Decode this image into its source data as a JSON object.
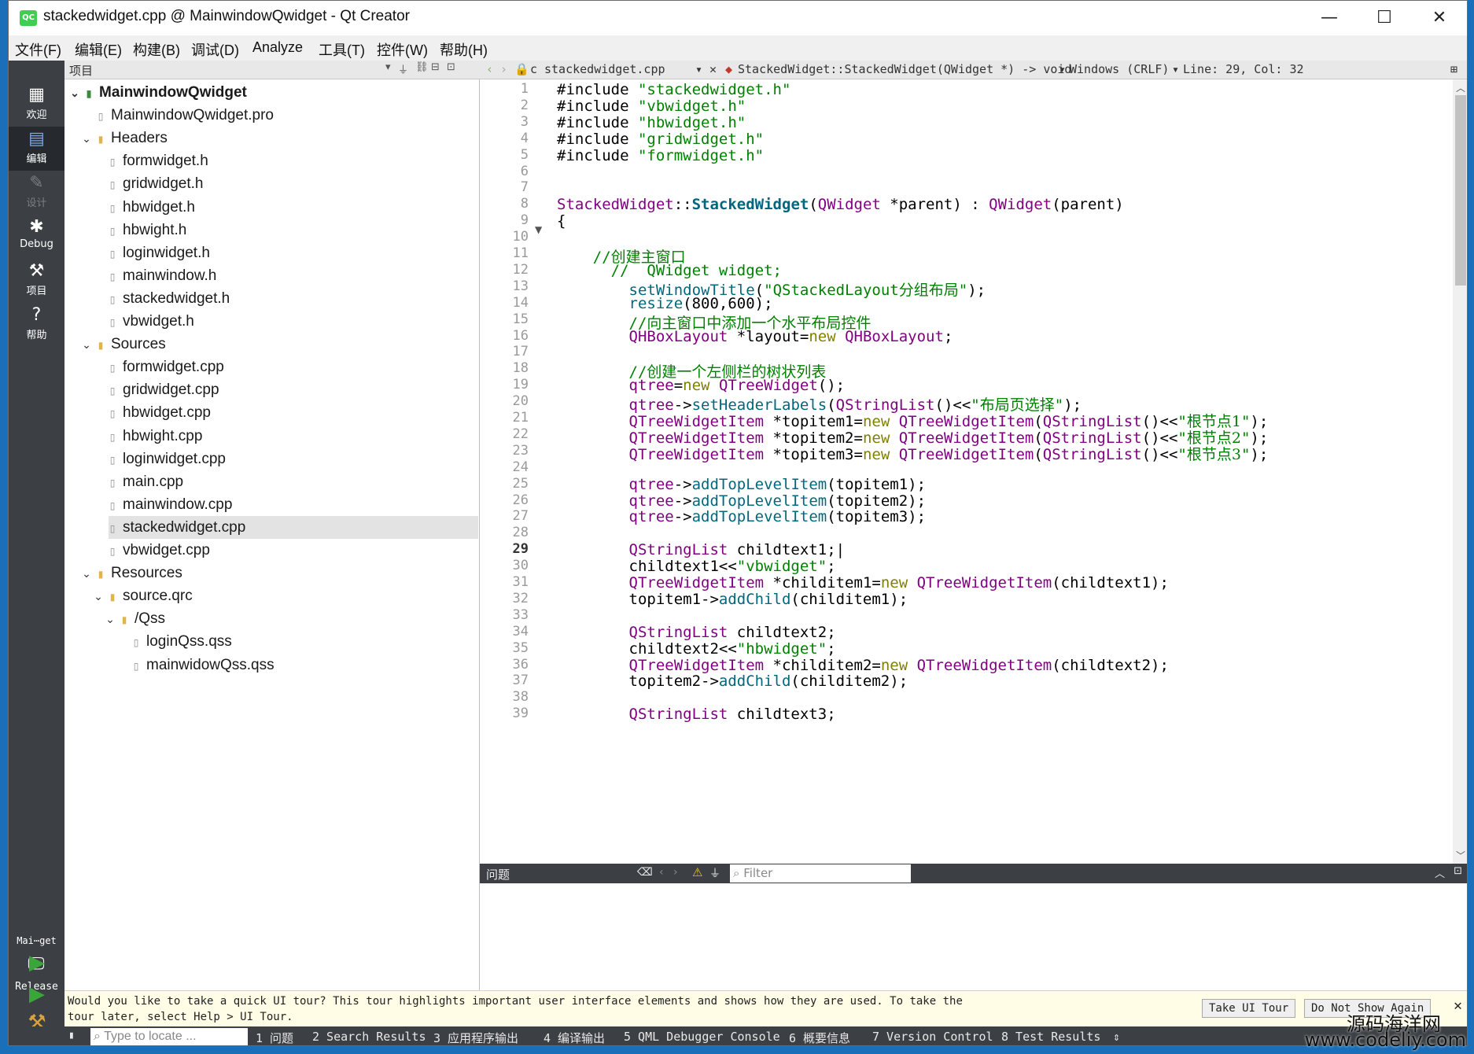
{
  "window": {
    "title": "stackedwidget.cpp @ MainwindowQwidget - Qt Creator",
    "app_icon": "QC",
    "minimize": "—",
    "maximize": "☐",
    "close": "✕"
  },
  "menubar": [
    "文件(F)",
    "编辑(E)",
    "构建(B)",
    "调试(D)",
    "Analyze",
    "工具(T)",
    "控件(W)",
    "帮助(H)"
  ],
  "modes": [
    {
      "label": "欢迎",
      "icon": "grid-icon"
    },
    {
      "label": "编辑",
      "icon": "edit-icon"
    },
    {
      "label": "设计",
      "icon": "pencil-icon"
    },
    {
      "label": "Debug",
      "icon": "bug-icon"
    },
    {
      "label": "项目",
      "icon": "wrench-icon"
    },
    {
      "label": "帮助",
      "icon": "help-icon"
    }
  ],
  "kit": {
    "project": "Mai⋯get",
    "config": "Release"
  },
  "project_pane": {
    "title": "项目",
    "tree": [
      {
        "label": "MainwindowQwidget",
        "level": 0,
        "expanded": true,
        "kind": "root"
      },
      {
        "label": "MainwindowQwidget.pro",
        "level": 1,
        "kind": "file"
      },
      {
        "label": "Headers",
        "level": 1,
        "expanded": true,
        "kind": "folder"
      },
      {
        "label": "formwidget.h",
        "level": 2,
        "kind": "file"
      },
      {
        "label": "gridwidget.h",
        "level": 2,
        "kind": "file"
      },
      {
        "label": "hbwidget.h",
        "level": 2,
        "kind": "file"
      },
      {
        "label": "hbwight.h",
        "level": 2,
        "kind": "file"
      },
      {
        "label": "loginwidget.h",
        "level": 2,
        "kind": "file"
      },
      {
        "label": "mainwindow.h",
        "level": 2,
        "kind": "file"
      },
      {
        "label": "stackedwidget.h",
        "level": 2,
        "kind": "file"
      },
      {
        "label": "vbwidget.h",
        "level": 2,
        "kind": "file"
      },
      {
        "label": "Sources",
        "level": 1,
        "expanded": true,
        "kind": "folder"
      },
      {
        "label": "formwidget.cpp",
        "level": 2,
        "kind": "file"
      },
      {
        "label": "gridwidget.cpp",
        "level": 2,
        "kind": "file"
      },
      {
        "label": "hbwidget.cpp",
        "level": 2,
        "kind": "file"
      },
      {
        "label": "hbwight.cpp",
        "level": 2,
        "kind": "file"
      },
      {
        "label": "loginwidget.cpp",
        "level": 2,
        "kind": "file"
      },
      {
        "label": "main.cpp",
        "level": 2,
        "kind": "file"
      },
      {
        "label": "mainwindow.cpp",
        "level": 2,
        "kind": "file"
      },
      {
        "label": "stackedwidget.cpp",
        "level": 2,
        "kind": "file",
        "selected": true
      },
      {
        "label": "vbwidget.cpp",
        "level": 2,
        "kind": "file"
      },
      {
        "label": "Resources",
        "level": 1,
        "expanded": true,
        "kind": "folder"
      },
      {
        "label": "source.qrc",
        "level": 2,
        "expanded": true,
        "kind": "folder"
      },
      {
        "label": "/Qss",
        "level": 3,
        "expanded": true,
        "kind": "folder"
      },
      {
        "label": "loginQss.qss",
        "level": 4,
        "kind": "file"
      },
      {
        "label": "mainwidowQss.qss",
        "level": 4,
        "kind": "file"
      }
    ]
  },
  "editor_toolbar": {
    "file": "stackedwidget.cpp",
    "symbol": "StackedWidget::StackedWidget(QWidget *) -> void",
    "line_endings": "Windows (CRLF)",
    "position": "Line: 29, Col: 32"
  },
  "editor": {
    "current_line": 29,
    "lines": [
      {
        "n": "1",
        "html": "#include <span class=\"str\">\"stackedwidget.h\"</span>"
      },
      {
        "n": "2",
        "html": "#include <span class=\"str\">\"vbwidget.h\"</span>"
      },
      {
        "n": "3",
        "html": "#include <span class=\"str\">\"hbwidget.h\"</span>"
      },
      {
        "n": "4",
        "html": "#include <span class=\"str\">\"gridwidget.h\"</span>"
      },
      {
        "n": "5",
        "html": "#include <span class=\"str\">\"formwidget.h\"</span>"
      },
      {
        "n": "6",
        "html": ""
      },
      {
        "n": "7",
        "html": ""
      },
      {
        "n": "8",
        "html": "<span class=\"typ\">StackedWidget</span>::<span class=\"bold\">StackedWidget</span>(<span class=\"typ\">QWidget</span> *parent) : <span class=\"typ\">QWidget</span>(parent)"
      },
      {
        "n": "9",
        "html": "{"
      },
      {
        "n": "10",
        "html": ""
      },
      {
        "n": "11",
        "html": "    <span class=\"cmt\">//</span><span class=\"cn\">创建主窗口</span>"
      },
      {
        "n": "12",
        "html": "      <span class=\"cmt\">//  QWidget widget;</span>"
      },
      {
        "n": "13",
        "html": "        <span class=\"fn\">setWindowTitle</span>(<span class=\"str\">\"QStackedLayout</span><span class=\"cn\">分组布局</span><span class=\"str\">\"</span>);"
      },
      {
        "n": "14",
        "html": "        <span class=\"fn\">resize</span>(800,600);"
      },
      {
        "n": "15",
        "html": "        <span class=\"cmt\">//</span><span class=\"cn\">向主窗口中添加一个水平布局控件</span>"
      },
      {
        "n": "16",
        "html": "        <span class=\"typ\">QHBoxLayout</span> *layout=<span class=\"kw\">new</span> <span class=\"typ\">QHBoxLayout</span>;"
      },
      {
        "n": "17",
        "html": ""
      },
      {
        "n": "18",
        "html": "        <span class=\"cmt\">//</span><span class=\"cn\">创建一个左侧栏的树状列表</span>"
      },
      {
        "n": "19",
        "html": "        <span class=\"typ\">qtree</span>=<span class=\"kw\">new</span> <span class=\"typ\">QTreeWidget</span>();"
      },
      {
        "n": "20",
        "html": "        <span class=\"typ\">qtree</span>-><span class=\"fn\">setHeaderLabels</span>(<span class=\"typ\">QStringList</span>()<<<span class=\"str\">\"</span><span class=\"cn\">布局页选择</span><span class=\"str\">\"</span>);"
      },
      {
        "n": "21",
        "html": "        <span class=\"typ\">QTreeWidgetItem</span> *topitem1=<span class=\"kw\">new</span> <span class=\"typ\">QTreeWidgetItem</span>(<span class=\"typ\">QStringList</span>()<<<span class=\"str\">\"</span><span class=\"cn\">根节点1</span><span class=\"str\">\"</span>);"
      },
      {
        "n": "22",
        "html": "        <span class=\"typ\">QTreeWidgetItem</span> *topitem2=<span class=\"kw\">new</span> <span class=\"typ\">QTreeWidgetItem</span>(<span class=\"typ\">QStringList</span>()<<<span class=\"str\">\"</span><span class=\"cn\">根节点2</span><span class=\"str\">\"</span>);"
      },
      {
        "n": "23",
        "html": "        <span class=\"typ\">QTreeWidgetItem</span> *topitem3=<span class=\"kw\">new</span> <span class=\"typ\">QTreeWidgetItem</span>(<span class=\"typ\">QStringList</span>()<<<span class=\"str\">\"</span><span class=\"cn\">根节点3</span><span class=\"str\">\"</span>);"
      },
      {
        "n": "24",
        "html": ""
      },
      {
        "n": "25",
        "html": "        <span class=\"typ\">qtree</span>-><span class=\"fn\">addTopLevelItem</span>(topitem1);"
      },
      {
        "n": "26",
        "html": "        <span class=\"typ\">qtree</span>-><span class=\"fn\">addTopLevelItem</span>(topitem2);"
      },
      {
        "n": "27",
        "html": "        <span class=\"typ\">qtree</span>-><span class=\"fn\">addTopLevelItem</span>(topitem3);"
      },
      {
        "n": "28",
        "html": ""
      },
      {
        "n": "29",
        "html": "        <span class=\"typ\">QStringList</span> childtext1;|"
      },
      {
        "n": "30",
        "html": "        childtext1<<<span class=\"str\">\"vbwidget\"</span>;"
      },
      {
        "n": "31",
        "html": "        <span class=\"typ\">QTreeWidgetItem</span> *childitem1=<span class=\"kw\">new</span> <span class=\"typ\">QTreeWidgetItem</span>(childtext1);"
      },
      {
        "n": "32",
        "html": "        topitem1-><span class=\"fn\">addChild</span>(childitem1);"
      },
      {
        "n": "33",
        "html": ""
      },
      {
        "n": "34",
        "html": "        <span class=\"typ\">QStringList</span> childtext2;"
      },
      {
        "n": "35",
        "html": "        childtext2<<<span class=\"str\">\"hbwidget\"</span>;"
      },
      {
        "n": "36",
        "html": "        <span class=\"typ\">QTreeWidgetItem</span> *childitem2=<span class=\"kw\">new</span> <span class=\"typ\">QTreeWidgetItem</span>(childtext2);"
      },
      {
        "n": "37",
        "html": "        topitem2-><span class=\"fn\">addChild</span>(childitem2);"
      },
      {
        "n": "38",
        "html": ""
      },
      {
        "n": "39",
        "html": "        <span class=\"typ\">QStringList</span> childtext3;"
      }
    ]
  },
  "issues": {
    "title": "问题",
    "filter_placeholder": "Filter"
  },
  "tour": {
    "text": "Would you like to take a quick UI tour? This tour highlights important user interface elements and shows how they are used. To take the tour later, select Help > UI Tour.",
    "take_label": "Take UI Tour",
    "dismiss_label": "Do Not Show Again",
    "close": "✕"
  },
  "statusbar": {
    "locate_placeholder": "Type to locate ...",
    "panes": [
      "1 问题",
      "2 Search Results",
      "3 应用程序输出",
      "4 编译输出",
      "5 QML Debugger Console",
      "6 概要信息",
      "7 Version Control",
      "8 Test Results"
    ],
    "more": "⇕"
  },
  "watermark": {
    "line1": "源码海洋网",
    "line2": "www.codeliy.com"
  }
}
